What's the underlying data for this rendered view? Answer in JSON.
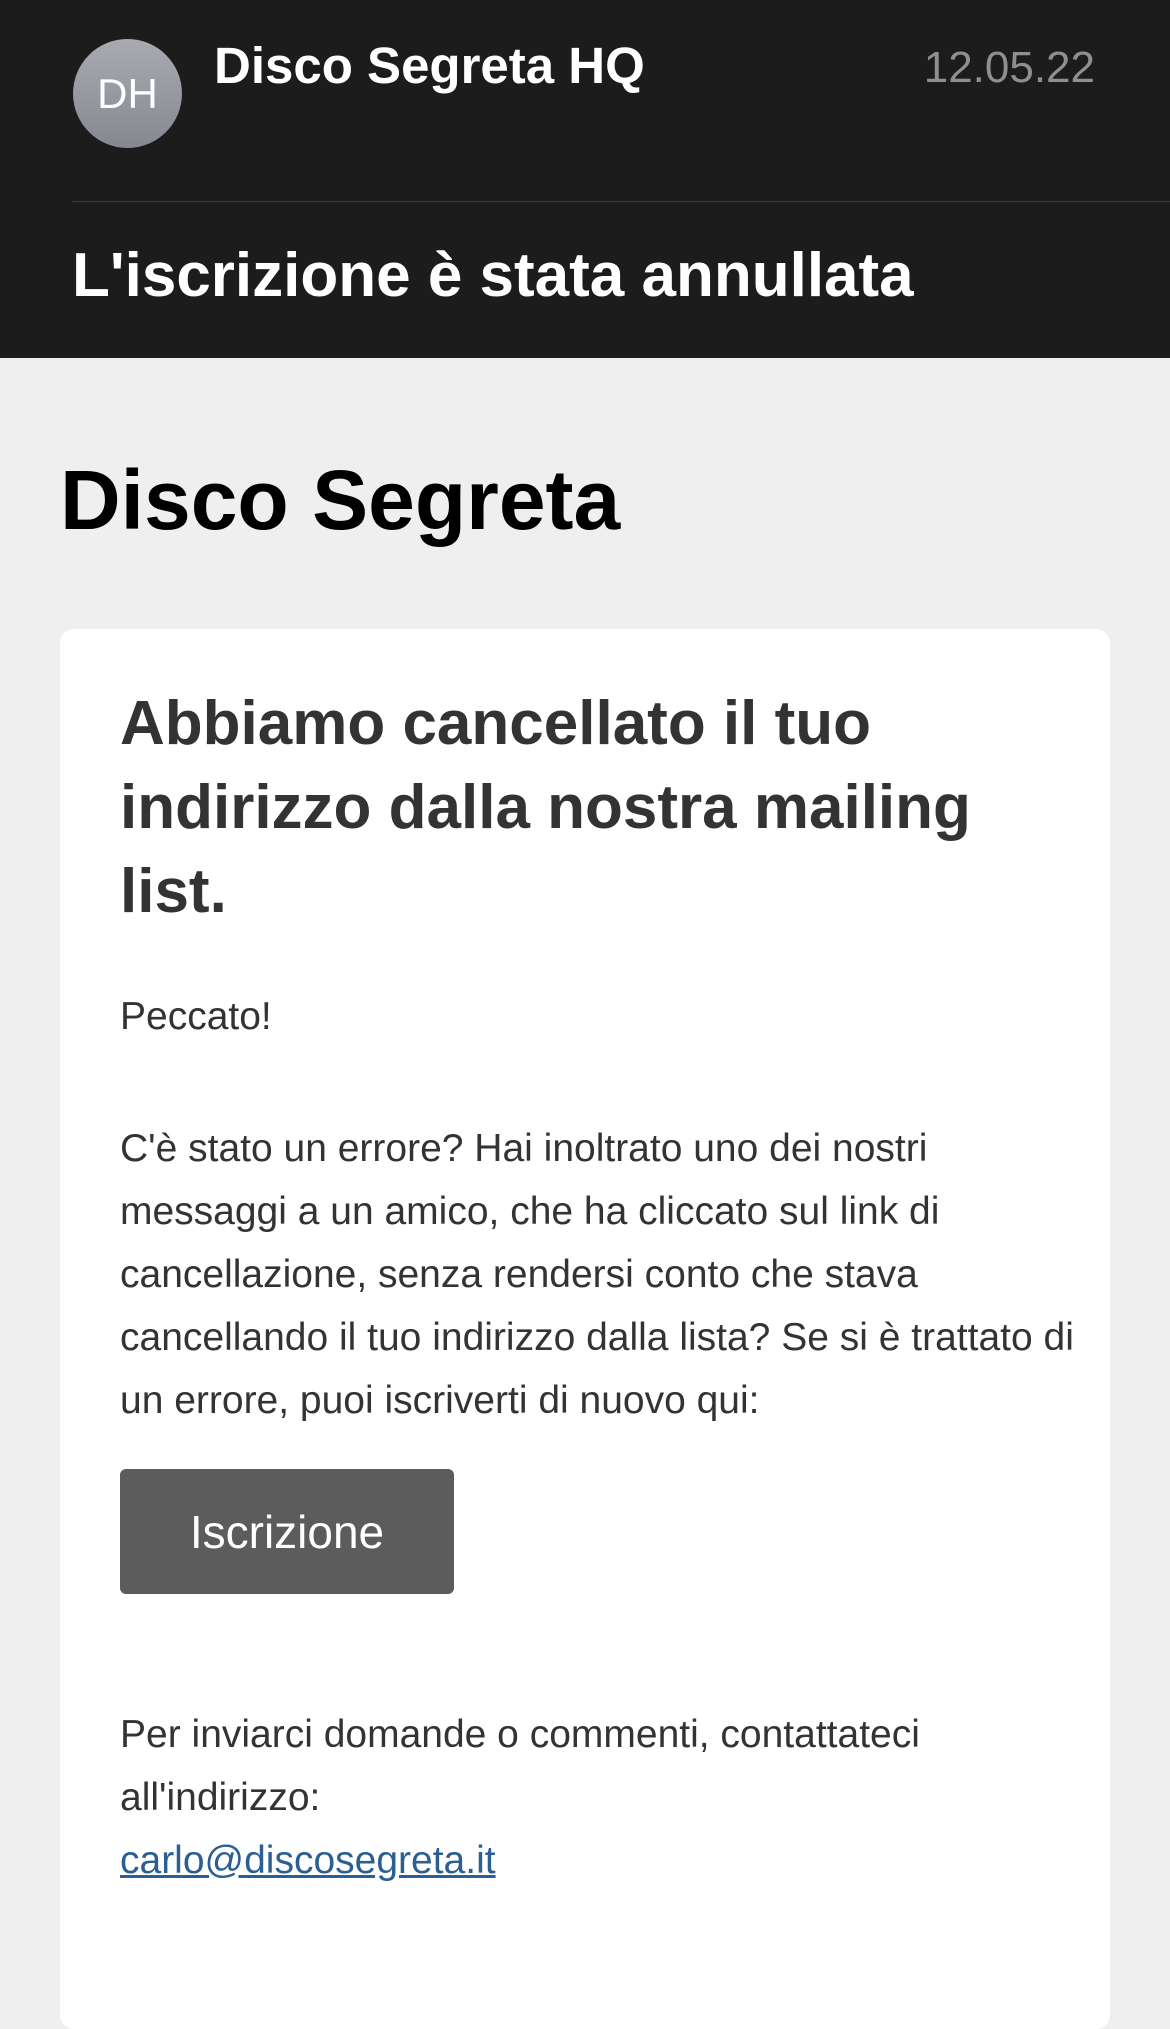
{
  "header": {
    "avatar_initials": "DH",
    "sender": "Disco Segreta HQ",
    "date": "12.05.22",
    "subject": "L'iscrizione è stata annullata"
  },
  "email": {
    "brand": "Disco Segreta",
    "title": "Abbiamo cancellato il tuo indirizzo dalla nostra mailing list.",
    "greeting": "Peccato!",
    "explanation": "C'è stato un errore? Hai inoltrato uno dei nostri messaggi a un amico, che ha cliccato sul link di cancellazione, senza rendersi conto che stava cancellando il tuo indirizzo dalla lista? Se si è trattato di un errore, puoi iscriverti di nuovo qui:",
    "subscribe_label": "Iscrizione",
    "contact_text": "Per inviarci domande o commenti, contattateci all'indirizzo:",
    "contact_email": "carlo@discosegreta.it"
  },
  "colors": {
    "header_background": "#1c1c1c",
    "page_background": "#efefef",
    "button_background": "#5c5c5c",
    "link": "#2b5f92"
  }
}
